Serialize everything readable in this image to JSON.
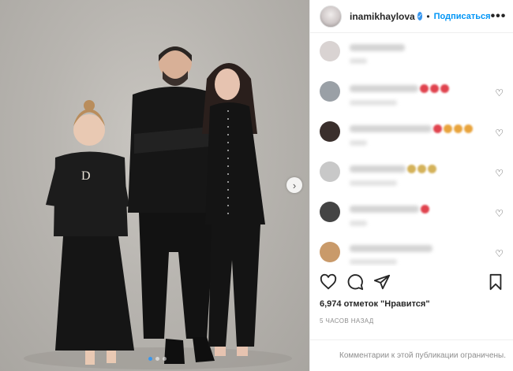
{
  "post": {
    "username": "inamikhaylova",
    "verified_icon": "✓",
    "separator": "•",
    "follow_label": "Подписаться",
    "more_label": "•••"
  },
  "carousel": {
    "next_icon": "›",
    "dots_total": 3,
    "active_dot": 1
  },
  "caption": {
    "author_avatar_icon": "avatar"
  },
  "comments": [
    {
      "avatar_color": "#d9d3d2",
      "emojis": [],
      "has_heart": false
    },
    {
      "avatar_color": "#9aa0a6",
      "emojis": [
        "#e0434e",
        "#e0434e",
        "#e0434e"
      ],
      "has_heart": true
    },
    {
      "avatar_color": "#3a2f2c",
      "emojis": [
        "#e0434e",
        "#e8a33c",
        "#e8a33c",
        "#e8a33c"
      ],
      "has_heart": true
    },
    {
      "avatar_color": "#c8c8c8",
      "emojis": [
        "#d4b25a",
        "#d4b25a",
        "#d4b25a"
      ],
      "has_heart": true
    },
    {
      "avatar_color": "#444",
      "emojis": [
        "#e0434e"
      ],
      "has_heart": true
    },
    {
      "avatar_color": "#c99a6a",
      "emojis": [],
      "has_heart": true
    }
  ],
  "actions": {
    "like_icon": "heart-outline",
    "comment_icon": "comment-bubble",
    "share_icon": "paper-plane",
    "save_icon": "bookmark"
  },
  "likes_text": "6,974 отметок \"Нравится\"",
  "time_text": "5 ЧАСОВ НАЗАД",
  "footer_text": "Комментарии к этой публикации ограничены.",
  "colors": {
    "accent": "#0095f6",
    "verified": "#3897f0",
    "text": "#262626",
    "muted": "#8e8e8e"
  }
}
